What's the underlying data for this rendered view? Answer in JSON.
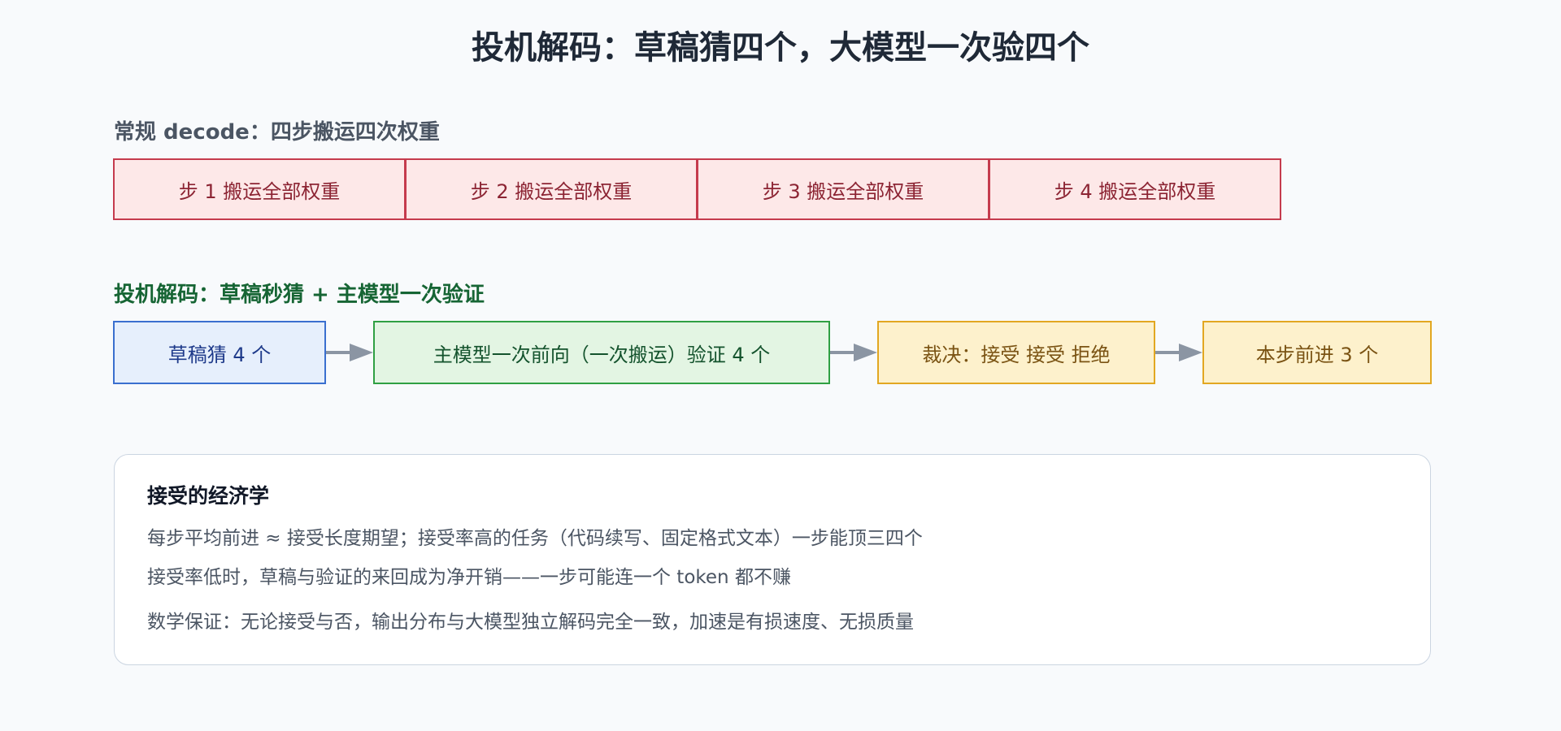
{
  "title": "投机解码：草稿猜四个，大模型一次验四个",
  "regular": {
    "label": "常规 decode：四步搬运四次权重",
    "steps": [
      "步 1 搬运全部权重",
      "步 2 搬运全部权重",
      "步 3 搬运全部权重",
      "步 4 搬运全部权重"
    ]
  },
  "speculative": {
    "label": "投机解码：草稿秒猜 + 主模型一次验证",
    "flow": [
      "草稿猜 4 个",
      "主模型一次前向（一次搬运）验证 4 个",
      "裁决：接受 接受 拒绝",
      "本步前进 3 个"
    ]
  },
  "card": {
    "title": "接受的经济学",
    "lines": [
      "每步平均前进 ≈ 接受长度期望；接受率高的任务（代码续写、固定格式文本）一步能顶三四个",
      "接受率低时，草稿与验证的来回成为净开销——一步可能连一个 token 都不赚",
      "数学保证：无论接受与否，输出分布与大模型独立解码完全一致，加速是有损速度、无损质量"
    ]
  },
  "colors": {
    "regular_border": "#c53b4d",
    "regular_fill": "#fde8e8",
    "draft_border": "#3a6fcf",
    "verify_border": "#2fa043",
    "judge_border": "#e2a721",
    "arrow": "#8b95a3"
  }
}
